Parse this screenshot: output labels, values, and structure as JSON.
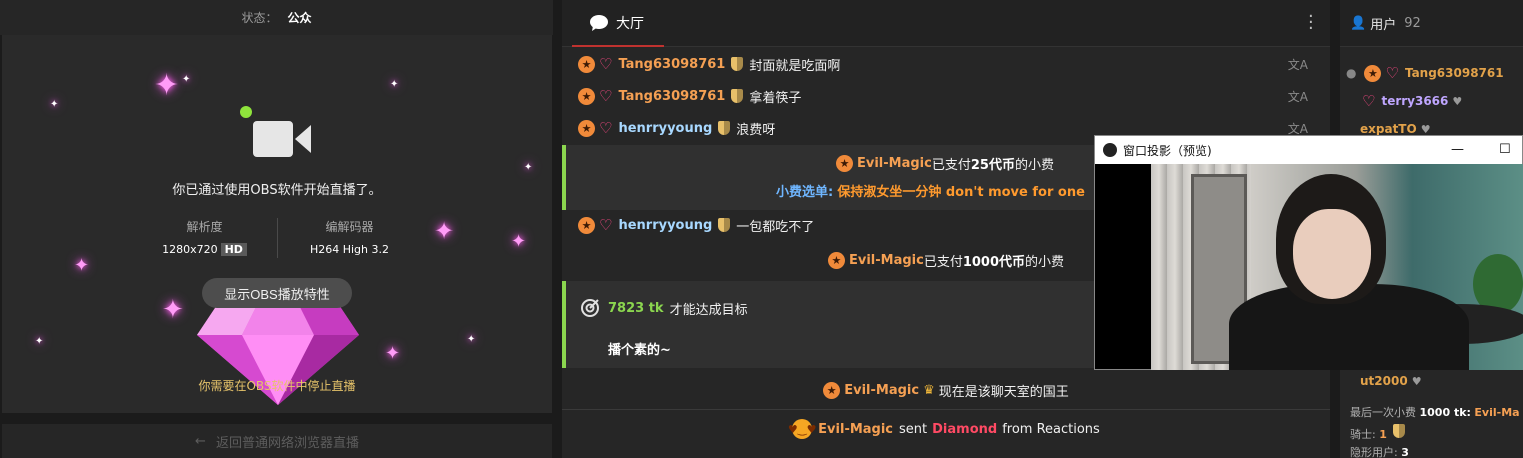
{
  "left": {
    "status_label": "状态：",
    "status_value": "公众",
    "started_text": "你已通过使用OBS软件开始直播了。",
    "resolution_title": "解析度",
    "resolution_value": "1280x720",
    "resolution_badge": "HD",
    "encoder_title": "编解码器",
    "encoder_value": "H264 High 3.2",
    "obs_button": "显示OBS播放特性",
    "stop_hint": "你需要在OBS软件中停止直播",
    "back_link": "返回普通网络浏览器直播"
  },
  "chat": {
    "tab_label": "大厅",
    "messages": [
      {
        "user": "Tang63098761",
        "text": "封面就是吃面啊"
      },
      {
        "user": "Tang63098761",
        "text": "拿着筷子"
      },
      {
        "user": "henrryyoung",
        "text": "浪费呀"
      }
    ],
    "tip1": {
      "user": "Evil-Magic",
      "pre": "已支付",
      "amount": "25代币",
      "post": "的小费",
      "menu_label": "小费选单:",
      "menu_item": "保持淑女坐一分钟 don't move for one"
    },
    "msg4": {
      "user": "henrryyoung",
      "text": "一包都吃不了"
    },
    "tip2": {
      "user": "Evil-Magic",
      "pre": "已支付",
      "amount": "1000代币",
      "post": "的小费"
    },
    "goal": {
      "tokens": "7823 tk",
      "text": "才能达成目标",
      "subtitle": "播个素的~"
    },
    "king": {
      "user": "Evil-Magic",
      "text": "现在是该聊天室的国王"
    },
    "reaction": {
      "user": "Evil-Magic",
      "verb": "sent",
      "item": "Diamond",
      "tail": "from Reactions"
    }
  },
  "users": {
    "title": "用户",
    "count": "92",
    "list": [
      {
        "name": "Tang63098761"
      },
      {
        "name": "terry3666"
      },
      {
        "name": "expatTO"
      }
    ],
    "partial": "ut2000",
    "last_tip_label": "最后一次小费",
    "last_tip_amount": "1000 tk:",
    "last_tip_user": "Evil-Ma",
    "knights_label": "骑士:",
    "knights_value": "1",
    "hidden_label": "隐形用户:",
    "hidden_value": "3"
  },
  "float_window": {
    "title": "窗口投影（预览)"
  }
}
